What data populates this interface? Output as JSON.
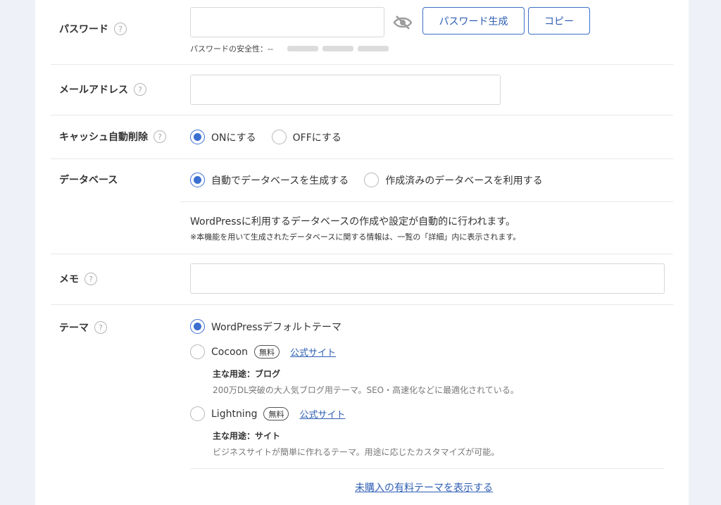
{
  "password": {
    "label": "パスワード",
    "value": "",
    "generate_label": "パスワード生成",
    "copy_label": "コピー",
    "strength_text": "パスワードの安全性：--"
  },
  "email": {
    "label": "メールアドレス",
    "value": ""
  },
  "cache": {
    "label": "キャッシュ自動削除",
    "options": [
      "ONにする",
      "OFFにする"
    ],
    "selected": "ONにする"
  },
  "database": {
    "label": "データベース",
    "options": [
      "自動でデータベースを生成する",
      "作成済みのデータベースを利用する"
    ],
    "selected": "自動でデータベースを生成する",
    "description": "WordPressに利用するデータベースの作成や設定が自動的に行われます。",
    "note": "※本機能を用いて生成されたデータベースに関する情報は、一覧の「詳細」内に表示されます。"
  },
  "memo": {
    "label": "メモ",
    "value": ""
  },
  "theme": {
    "label": "テーマ",
    "selected": "WordPressデフォルトテーマ",
    "options": [
      {
        "name": "WordPressデフォルトテーマ"
      },
      {
        "name": "Cocoon",
        "tag": "無料",
        "link": "公式サイト",
        "usage": "主な用途：ブログ",
        "desc": "200万DL突破の大人気ブログ用テーマ。SEO・高速化などに最適化されている。"
      },
      {
        "name": "Lightning",
        "tag": "無料",
        "link": "公式サイト",
        "usage": "主な用途：サイト",
        "desc": "ビジネスサイトが簡単に作れるテーマ。用途に応じたカスタマイズが可能。"
      }
    ],
    "paid_link": "未購入の有料テーマを表示する"
  },
  "icons": {
    "help": "help-icon",
    "eye_off": "eye-off-icon"
  },
  "colors": {
    "accent": "#3b6fd0",
    "link": "#2e5eb3",
    "background": "#eef2f8"
  }
}
